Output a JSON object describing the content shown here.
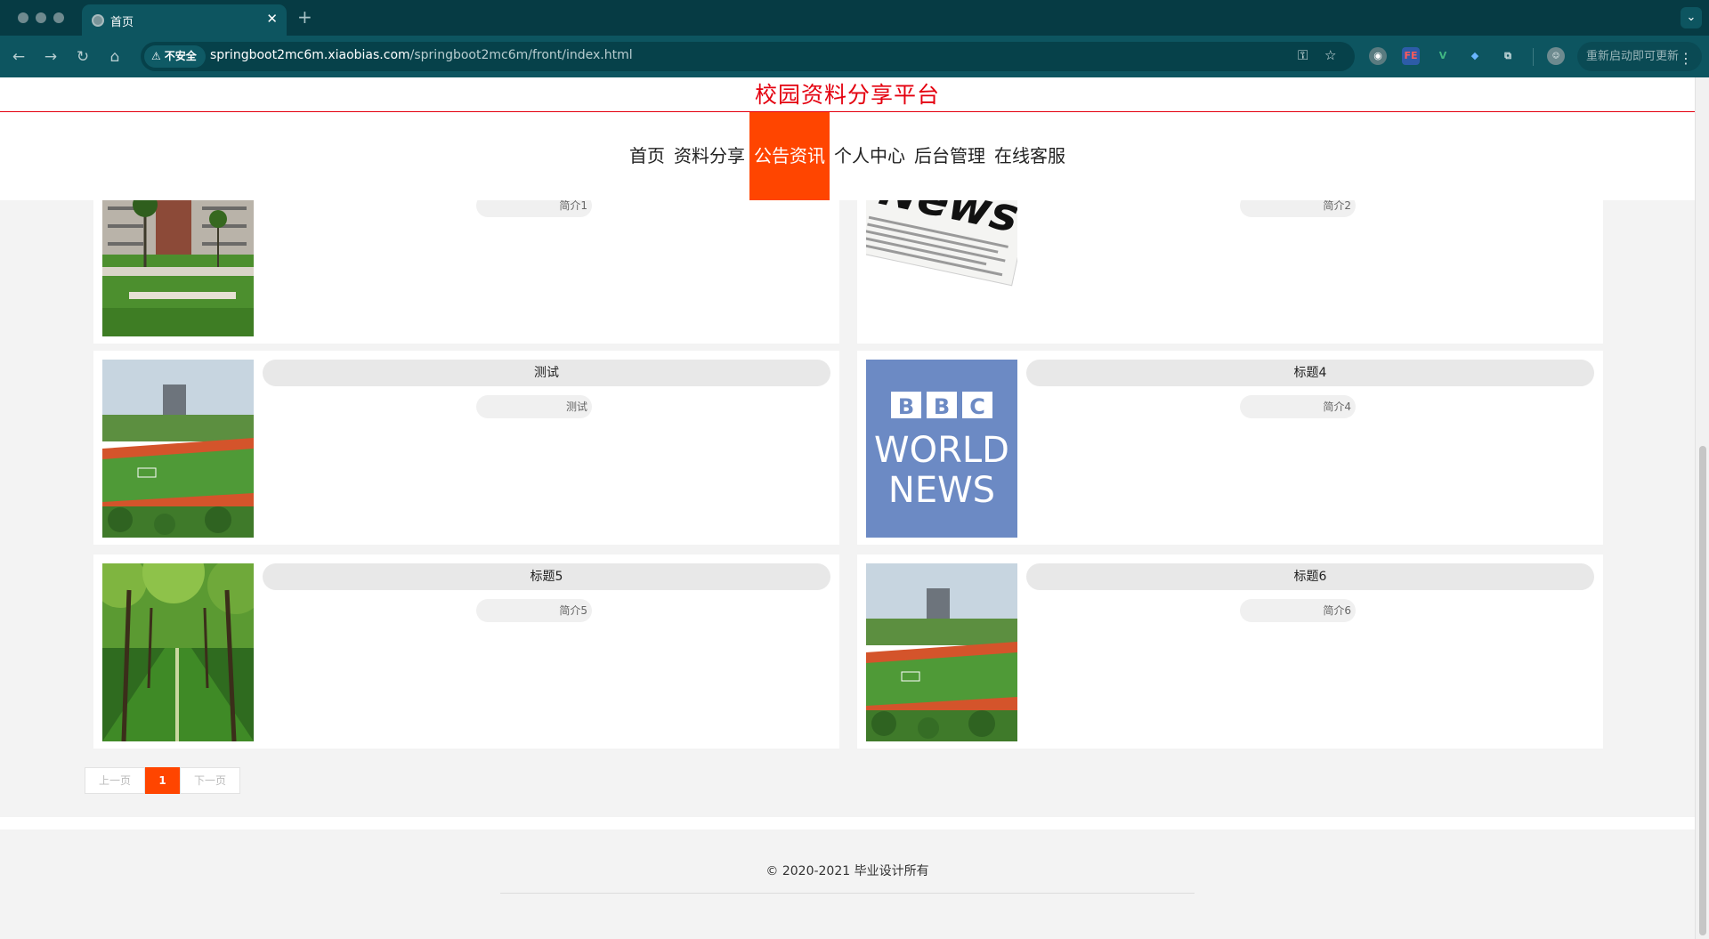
{
  "browser": {
    "tab_title": "首页",
    "security_label": "不安全",
    "url_host": "springboot2mc6m.xiaobias.com",
    "url_path": "/springboot2mc6m/front/index.html",
    "update_label": "重新启动即可更新",
    "extensions": [
      "FE",
      "V"
    ]
  },
  "site": {
    "title": "校园资料分享平台",
    "nav": [
      "首页",
      "资料分享",
      "公告资讯",
      "个人中心",
      "后台管理",
      "在线客服"
    ],
    "active_nav": "公告资讯"
  },
  "news": [
    {
      "title": "",
      "desc": "简介1",
      "image": "campus-building"
    },
    {
      "title": "",
      "desc": "简介2",
      "image": "newspaper"
    },
    {
      "title": "测试",
      "desc": "测试",
      "image": "sports-field"
    },
    {
      "title": "标题4",
      "desc": "简介4",
      "image": "bbc-world-news"
    },
    {
      "title": "标题5",
      "desc": "简介5",
      "image": "tree-path"
    },
    {
      "title": "标题6",
      "desc": "简介6",
      "image": "sports-field"
    }
  ],
  "bbc": {
    "line1": "BBC",
    "line2": "WORLD",
    "line3": "NEWS"
  },
  "news_word": "News",
  "pagination": {
    "prev": "上一页",
    "current": "1",
    "next": "下一页"
  },
  "footer": {
    "copyright": "© 2020-2021 毕业设计所有"
  }
}
